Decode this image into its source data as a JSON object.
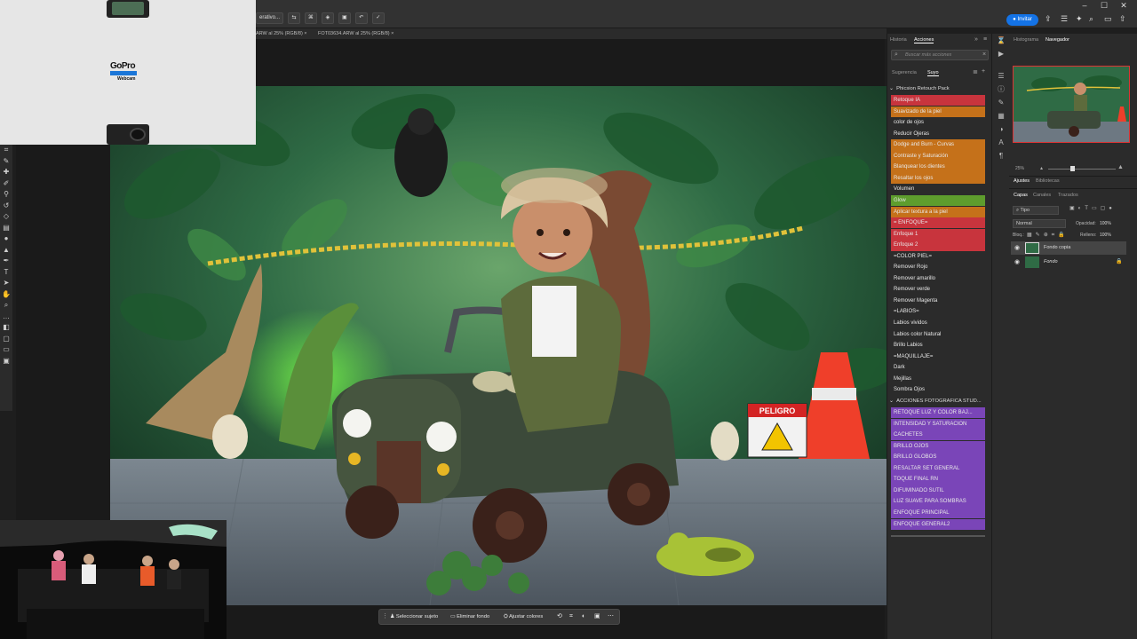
{
  "window": {
    "minimize": "–",
    "maximize": "☐",
    "close": "✕"
  },
  "topbar": {
    "invite_label": "Invitar",
    "options": [
      "erativo...",
      "⇆",
      "⌘",
      "◈",
      "▣",
      "↶",
      "✓"
    ]
  },
  "doc_tabs": [
    {
      "label": "ARW al 25% (RGB/8) ×"
    },
    {
      "label": "FOT03634.ARW al 25% (RGB/8) ×"
    }
  ],
  "gopro": {
    "brand": "GoPro",
    "subtitle": "Webcam"
  },
  "actions_panel": {
    "tabs": [
      "Historia",
      "Acciones"
    ],
    "search_placeholder": "Buscar más acciones",
    "subtabs": [
      "Sugerencia",
      "Suyo"
    ],
    "set1_title": "Phicsion Retouch Pack",
    "set1_items": [
      {
        "label": "Retoque IA",
        "color": "red"
      },
      {
        "label": "Suavizado de la piel",
        "color": "orange"
      },
      {
        "label": "color de ojos",
        "color": "none"
      },
      {
        "label": "Reducir Ojeras",
        "color": "none"
      },
      {
        "label": "Dodge and Burn - Curvas",
        "color": "orange"
      },
      {
        "label": "Contraste y Saturación",
        "color": "orange"
      },
      {
        "label": "Blanquear los dientes",
        "color": "orange"
      },
      {
        "label": "Resaltar los ojos",
        "color": "orange"
      },
      {
        "label": "Volumen",
        "color": "none"
      },
      {
        "label": "Glow",
        "color": "green"
      },
      {
        "label": "Aplicar textura a la piel",
        "color": "orange"
      },
      {
        "label": "= ENFOQUE=",
        "color": "red"
      },
      {
        "label": "Enfoque 1",
        "color": "red"
      },
      {
        "label": "Enfoque 2",
        "color": "red"
      },
      {
        "label": "=COLOR PIEL=",
        "color": "none"
      },
      {
        "label": "Remover Rojo",
        "color": "none"
      },
      {
        "label": "Remover amarillo",
        "color": "none"
      },
      {
        "label": "Remover verde",
        "color": "none"
      },
      {
        "label": "Remover Magenta",
        "color": "none"
      },
      {
        "label": "=LABIOS=",
        "color": "none"
      },
      {
        "label": "Labios vividos",
        "color": "none"
      },
      {
        "label": "Labios color Natural",
        "color": "none"
      },
      {
        "label": "Brillo Labios",
        "color": "none"
      },
      {
        "label": "=MAQUILLAJE=",
        "color": "none"
      },
      {
        "label": "Dark",
        "color": "none"
      },
      {
        "label": "Mejillas",
        "color": "none"
      },
      {
        "label": "Sombra Ojos",
        "color": "none"
      }
    ],
    "set2_title": "ACCIONES FOTOGRAFICA STUD...",
    "set2_items": [
      {
        "label": "RETOQUE LUZ Y COLOR BAJ...",
        "color": "purple"
      },
      {
        "label": "INTENSIDAD Y SATURACION",
        "color": "purple"
      },
      {
        "label": "CACHETES",
        "color": "purple"
      },
      {
        "label": "BRILLO OJOS",
        "color": "purple"
      },
      {
        "label": "BRILLO GLOBOS",
        "color": "purple"
      },
      {
        "label": "RESALTAR SET GENERAL",
        "color": "purple"
      },
      {
        "label": "TOQUE FINAL RN",
        "color": "purple"
      },
      {
        "label": "DIFUMINADO SUTIL",
        "color": "purple"
      },
      {
        "label": "LUZ SUAVE PARA SOMBRAS",
        "color": "purple"
      },
      {
        "label": "ENFOQUE PRINCIPAL",
        "color": "purple"
      },
      {
        "label": "ENFOQUE GENERAL2",
        "color": "purple"
      }
    ]
  },
  "right_panel": {
    "tabs_top": [
      "Histograma",
      "Navegador"
    ],
    "zoom": "25%",
    "tabs_mid": [
      "Ajustes",
      "Bibliotecas"
    ],
    "tabs_layers": [
      "Capas",
      "Canales",
      "Trazados"
    ],
    "kind_filter": "Tipo",
    "blend_mode": "Normal",
    "opacity_label": "Opacidad:",
    "opacity_value": "100%",
    "lock_label": "Bloq.:",
    "fill_label": "Relleno:",
    "fill_value": "100%",
    "layers": [
      {
        "name": "Fondo copia",
        "selected": true
      },
      {
        "name": "Fondo",
        "selected": false
      }
    ]
  },
  "context_bar": {
    "select_subject": "Seleccionar sujeto",
    "remove_bg": "Eliminar fondo",
    "adjust_colors": "Ajustar colores"
  },
  "photo_signs": {
    "peligro": "PELIGRO"
  }
}
